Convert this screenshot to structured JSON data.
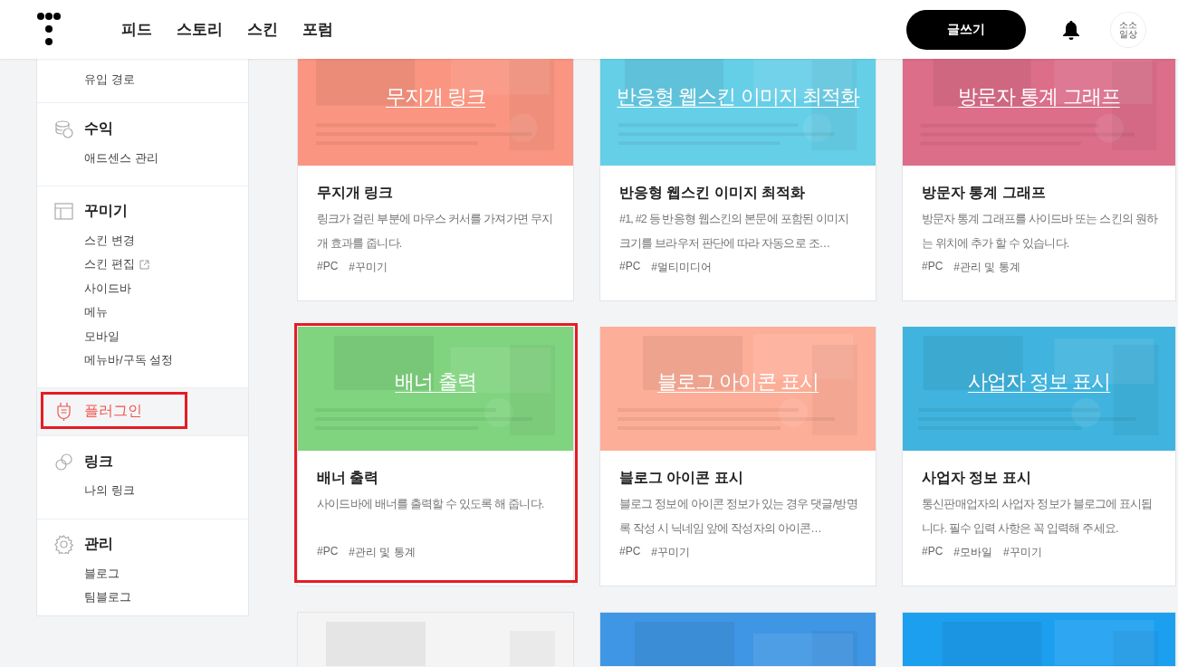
{
  "header": {
    "nav": [
      {
        "label": "피드"
      },
      {
        "label": "스토리"
      },
      {
        "label": "스킨"
      },
      {
        "label": "포럼"
      }
    ],
    "write_button": "글쓰기",
    "avatar_text": "소소 일상"
  },
  "sidebar": {
    "sections": [
      {
        "kind": "items",
        "items": [
          {
            "label": "유입 경로"
          }
        ]
      },
      {
        "kind": "section",
        "title": "수익",
        "selected": false,
        "annotated": false,
        "items": [
          {
            "label": "애드센스 관리"
          }
        ]
      },
      {
        "kind": "section",
        "title": "꾸미기",
        "selected": false,
        "annotated": false,
        "items": [
          {
            "label": "스킨 변경"
          },
          {
            "label": "스킨 편집",
            "external": true
          },
          {
            "label": "사이드바",
            "external": false
          },
          {
            "label": "메뉴"
          },
          {
            "label": "모바일"
          },
          {
            "label": "메뉴바/구독 설정"
          }
        ]
      },
      {
        "kind": "section",
        "title": "플러그인",
        "selected": true,
        "annotated": true
      },
      {
        "kind": "section",
        "title": "링크",
        "selected": false,
        "annotated": false,
        "items": [
          {
            "label": "나의 링크"
          }
        ]
      },
      {
        "kind": "section",
        "title": "관리",
        "selected": false,
        "annotated": false,
        "items": [
          {
            "label": "블로그"
          },
          {
            "label": "팀블로그"
          }
        ]
      }
    ]
  },
  "cards": [
    {
      "kind": "card",
      "color": "#f99580",
      "image_title": "무지개 링크",
      "title": "무지개 링크",
      "description": "링크가 걸린 부분에 마우스 커서를 가져가면 무지개 효과를 줍니다.",
      "tags": [
        "#PC",
        "#꾸미기"
      ],
      "annotated": false
    },
    {
      "kind": "card",
      "color": "#66cfe8",
      "image_title": "반응형 웹스킨 이미지 최적화",
      "title": "반응형 웹스킨 이미지 최적화",
      "description": "#1, #2 등 반응형 웹스킨의 본문에 포함된 이미지 크기를 브라우저 판단에 따라 자동으로 조…",
      "tags": [
        "#PC",
        "#멀티미디어"
      ],
      "annotated": false
    },
    {
      "kind": "card",
      "color": "#dc6e8a",
      "image_title": "방문자 통계 그래프",
      "title": "방문자 통계 그래프",
      "description": "방문자 통계 그래프를 사이드바 또는 스킨의 원하는 위치에 추가 할 수 있습니다.",
      "tags": [
        "#PC",
        "#관리 및 통계"
      ],
      "annotated": false
    },
    {
      "kind": "card",
      "color": "#80d480",
      "image_title": "배너 출력",
      "title": "배너 출력",
      "description": "사이드바에 배너를 출력할 수 있도록 해 줍니다.",
      "tags": [
        "#PC",
        "#관리 및 통계"
      ],
      "annotated": true
    },
    {
      "kind": "card",
      "color": "#fdae98",
      "image_title": "블로그 아이콘 표시",
      "title": "블로그 아이콘 표시",
      "description": "블로그 정보에 아이콘 정보가 있는 경우 댓글/방명록 작성 시 닉네임 앞에 작성자의 아이콘…",
      "tags": [
        "#PC",
        "#꾸미기"
      ],
      "annotated": false
    },
    {
      "kind": "card",
      "color": "#40b4de",
      "image_title": "사업자 정보 표시",
      "title": "사업자 정보 표시",
      "description": "통신판매업자의 사업자 정보가 블로그에 표시됩니다. 필수 입력 사항은 꼭 입력해 주세요.",
      "tags": [
        "#PC",
        "#모바일",
        "#꾸미기"
      ],
      "annotated": false
    },
    {
      "kind": "preview",
      "color": "#f4f4f4"
    },
    {
      "kind": "preview",
      "color": "#3f96e4"
    },
    {
      "kind": "preview",
      "color": "#1d9ff0"
    }
  ]
}
